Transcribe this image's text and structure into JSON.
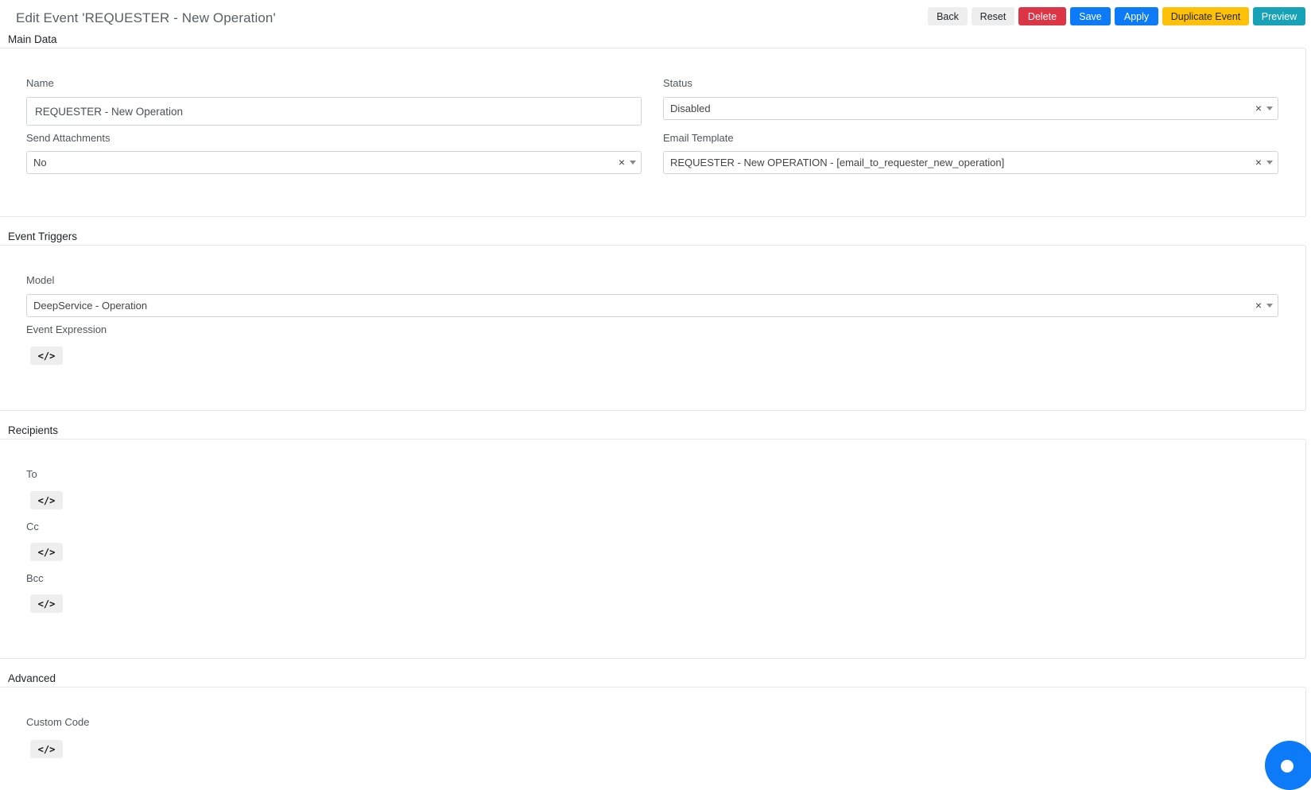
{
  "header": {
    "title": "Edit Event 'REQUESTER - New Operation'"
  },
  "toolbar": {
    "back": "Back",
    "reset": "Reset",
    "delete": "Delete",
    "save": "Save",
    "apply": "Apply",
    "duplicate": "Duplicate Event",
    "preview": "Preview"
  },
  "main_data": {
    "title": "Main Data",
    "name_label": "Name",
    "name_value": "REQUESTER - New Operation",
    "status_label": "Status",
    "status_value": "Disabled",
    "attachments_label": "Send Attachments",
    "attachments_value": "No",
    "template_label": "Email Template",
    "template_value": "REQUESTER - New OPERATION - [email_to_requester_new_operation]"
  },
  "triggers": {
    "title": "Event Triggers",
    "model_label": "Model",
    "model_value": "DeepService - Operation",
    "expression_label": "Event Expression"
  },
  "recipients": {
    "title": "Recipients",
    "to_label": "To",
    "cc_label": "Cc",
    "bcc_label": "Bcc"
  },
  "advanced": {
    "title": "Advanced",
    "custom_code_label": "Custom Code"
  },
  "common": {
    "code_glyph": "</>",
    "clear_glyph": "×"
  },
  "colors": {
    "primary": "#0d7bf7",
    "danger": "#dc3545",
    "warning": "#ffc107",
    "info": "#17a2b8",
    "light": "#eeeeee"
  },
  "icons": {
    "code": "code-icon",
    "clear": "clear-icon",
    "caret": "chevron-down-icon",
    "chat": "chat-icon"
  }
}
